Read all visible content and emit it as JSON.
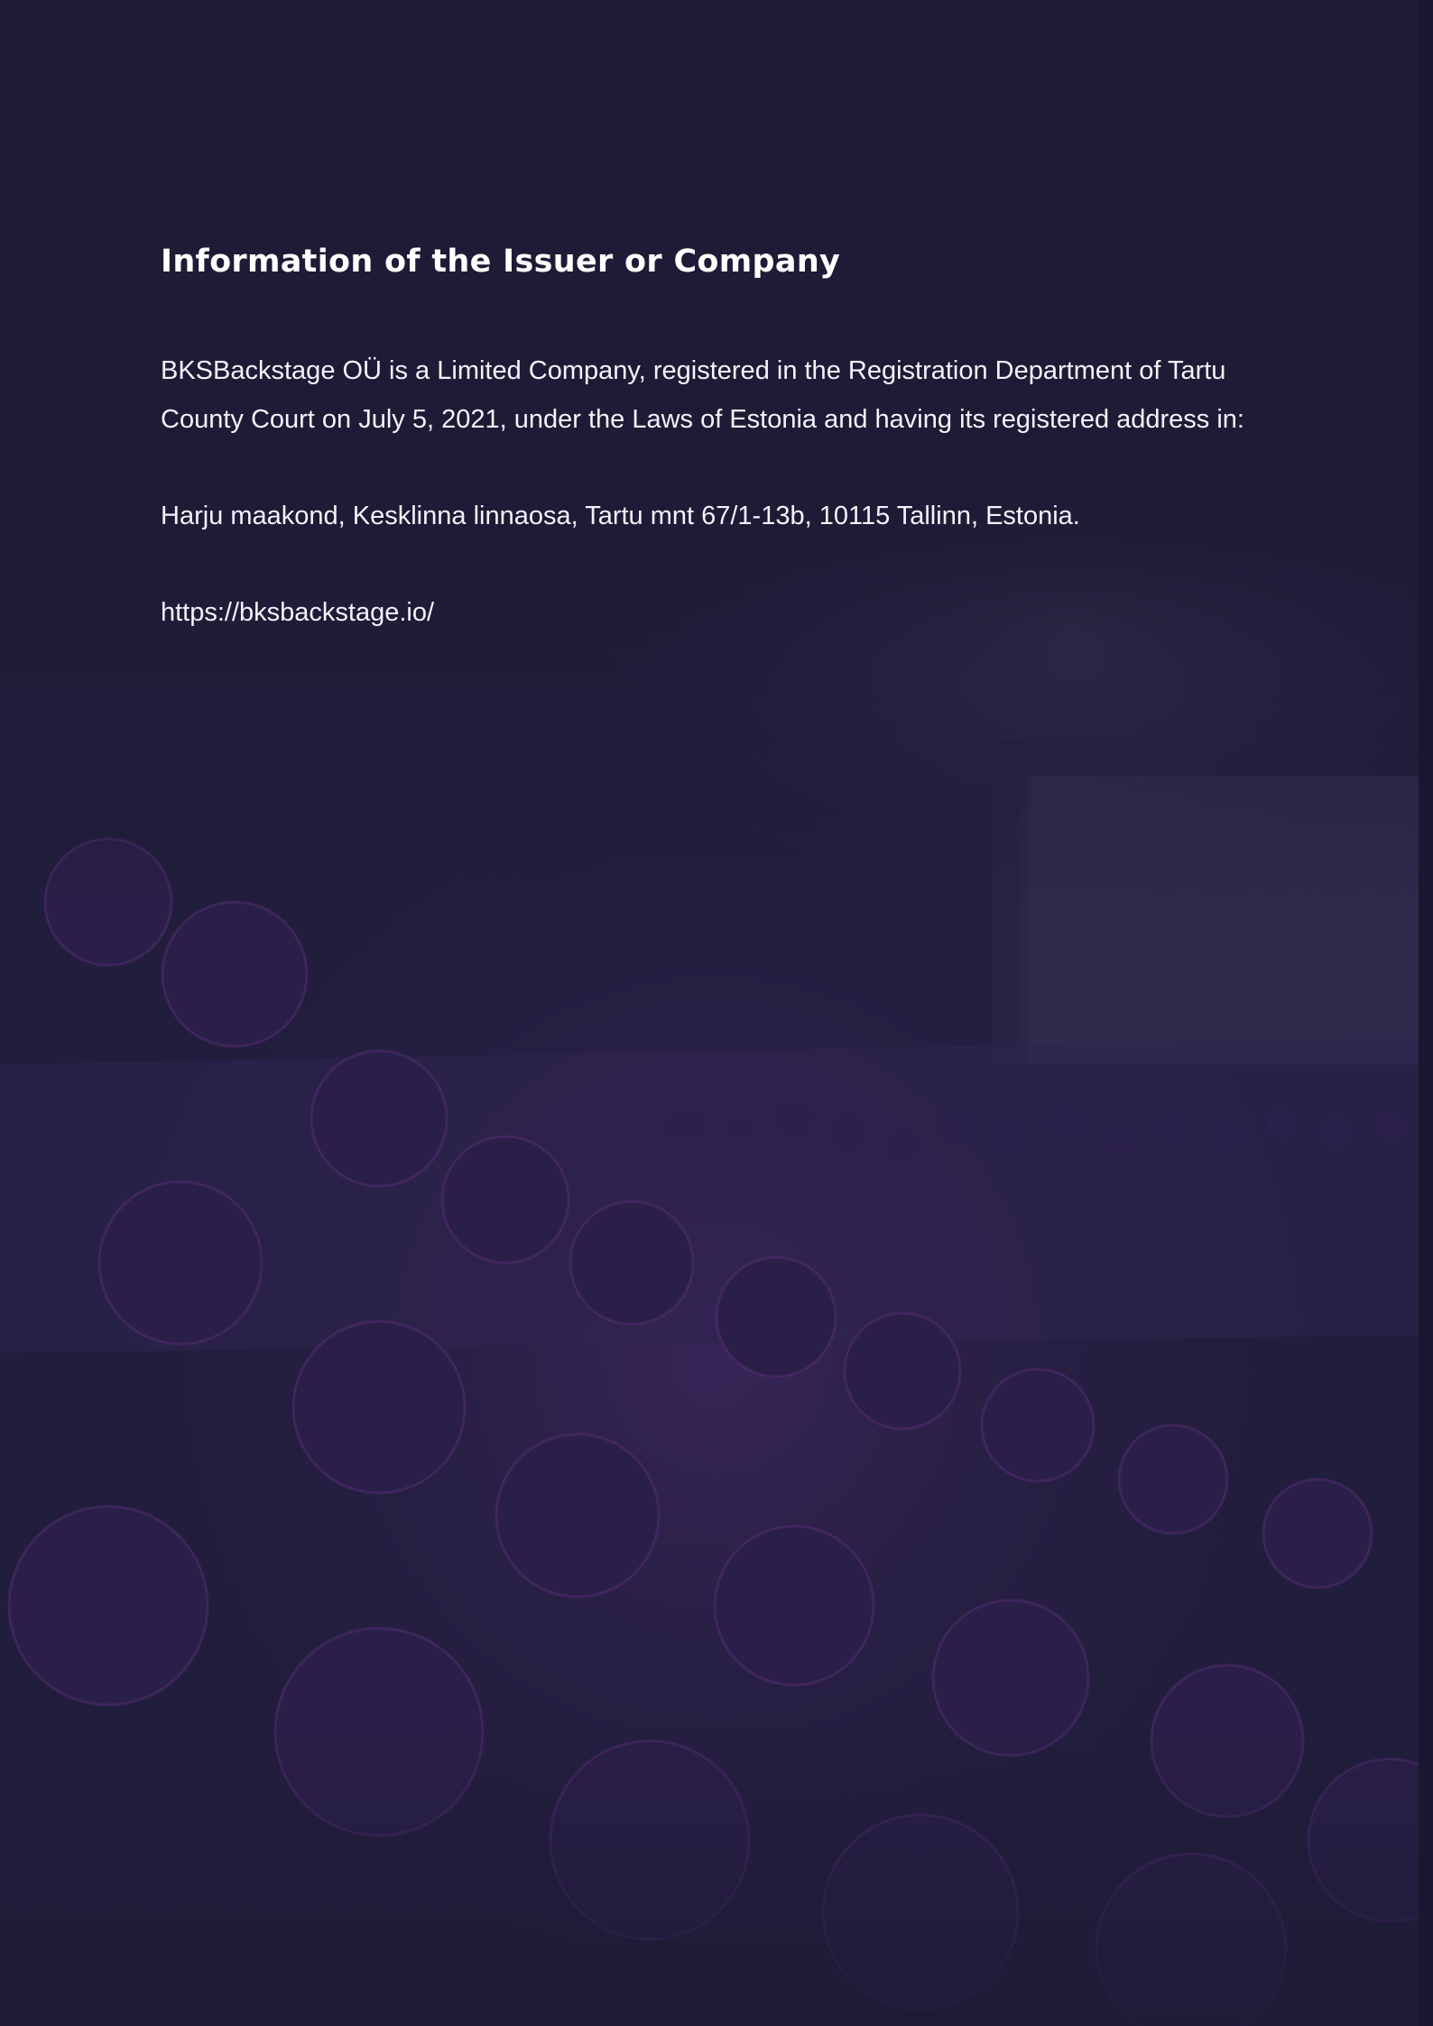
{
  "section": {
    "title": "Information of the Issuer or Company",
    "intro": "BKSBackstage OÜ is a Limited Company, registered in the Registration Department of Tartu County Court on July 5, 2021, under the Laws of Estonia and having its registered address in:",
    "address": "Harju maakond, Kesklinna linnaosa, Tartu mnt 67/1-13b, 10115 Tallinn, Estonia.",
    "website": "https://bksbackstage.io/"
  },
  "colors": {
    "background": "#1e1b36",
    "text": "#ffffff",
    "accent_purple": "#4a2c6e"
  }
}
